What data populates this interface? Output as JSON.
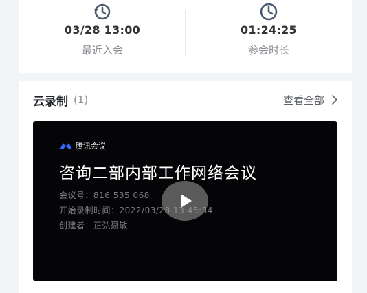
{
  "stats": {
    "last_join": {
      "value": "03/28 13:00",
      "label": "最近入会"
    },
    "duration": {
      "value": "01:24:25",
      "label": "参会时长"
    }
  },
  "cloud_recording": {
    "title": "云录制",
    "count": "(1)",
    "view_all": "查看全部"
  },
  "video": {
    "brand": "腾讯会议",
    "title": "咨询二部内部工作网络会议",
    "meeting_id": "会议号：816 535 068",
    "start_time": "开始录制时间：2022/03/28 13:45:34",
    "creator": "创建者：正弘聂敏"
  },
  "colors": {
    "icon": "#4a5a70",
    "brand": "#2f6bff"
  }
}
